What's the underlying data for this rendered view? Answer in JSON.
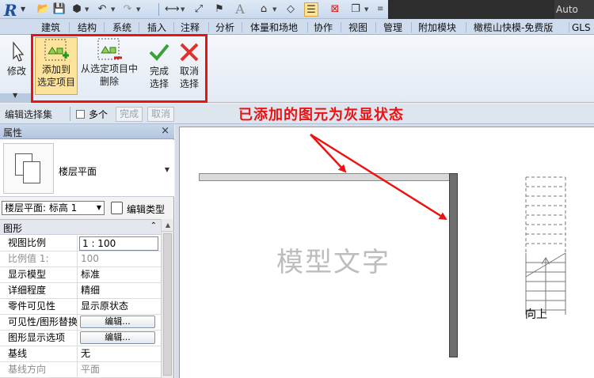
{
  "window": {
    "title_partial": "Auto"
  },
  "quick_access": {
    "icons": [
      "revit-logo-icon",
      "open-icon",
      "save-icon",
      "sync-icon",
      "undo-icon",
      "redo-icon",
      "measure-icon",
      "dimension-icon",
      "tag-icon",
      "text-A-icon",
      "3d-view-icon",
      "section-icon",
      "thin-lines-icon",
      "close-windows-icon",
      "switch-windows-icon",
      "customize-icon"
    ]
  },
  "ribbon_tabs": [
    "建筑",
    "结构",
    "系统",
    "插入",
    "注释",
    "分析",
    "体量和场地",
    "协作",
    "视图",
    "管理",
    "附加模块",
    "橄榄山快模-免费版",
    "GLS土"
  ],
  "ribbon": {
    "modify_label": "修改",
    "add_to_selection": {
      "line1": "添加到",
      "line2": "选定项目"
    },
    "remove_from_selection": {
      "line1": "从选定项目中",
      "line2": "删除"
    },
    "finish_selection": {
      "line1": "完成",
      "line2": "选择"
    },
    "cancel_selection": {
      "line1": "取消",
      "line2": "选择"
    }
  },
  "edit_selection_bar": {
    "label": "编辑选择集",
    "multiple_label": "多个",
    "finish_button": "完成",
    "cancel_button": "取消"
  },
  "annotation": "已添加的图元为灰显状态",
  "properties": {
    "title": "属性",
    "close": "×",
    "type_name": "楼层平面",
    "instance_selector": "楼层平面: 标高 1",
    "edit_type": "编辑类型",
    "group": "图形",
    "rows": [
      {
        "key": "视图比例",
        "value": "1 : 100"
      },
      {
        "key": "比例值 1:",
        "value": "100"
      },
      {
        "key": "显示模型",
        "value": "标准"
      },
      {
        "key": "详细程度",
        "value": "精细"
      },
      {
        "key": "零件可见性",
        "value": "显示原状态"
      },
      {
        "key": "可见性/图形替换",
        "value": "编辑..."
      },
      {
        "key": "图形显示选项",
        "value": "编辑..."
      },
      {
        "key": "基线",
        "value": "无"
      },
      {
        "key": "基线方向",
        "value": "平面"
      }
    ]
  },
  "canvas": {
    "model_text": "模型文字",
    "stair_label": "向上"
  },
  "colors": {
    "annotation_red": "#ee1111",
    "selected_button": "#fde39b",
    "wall_gray": "#d9d9d9"
  }
}
